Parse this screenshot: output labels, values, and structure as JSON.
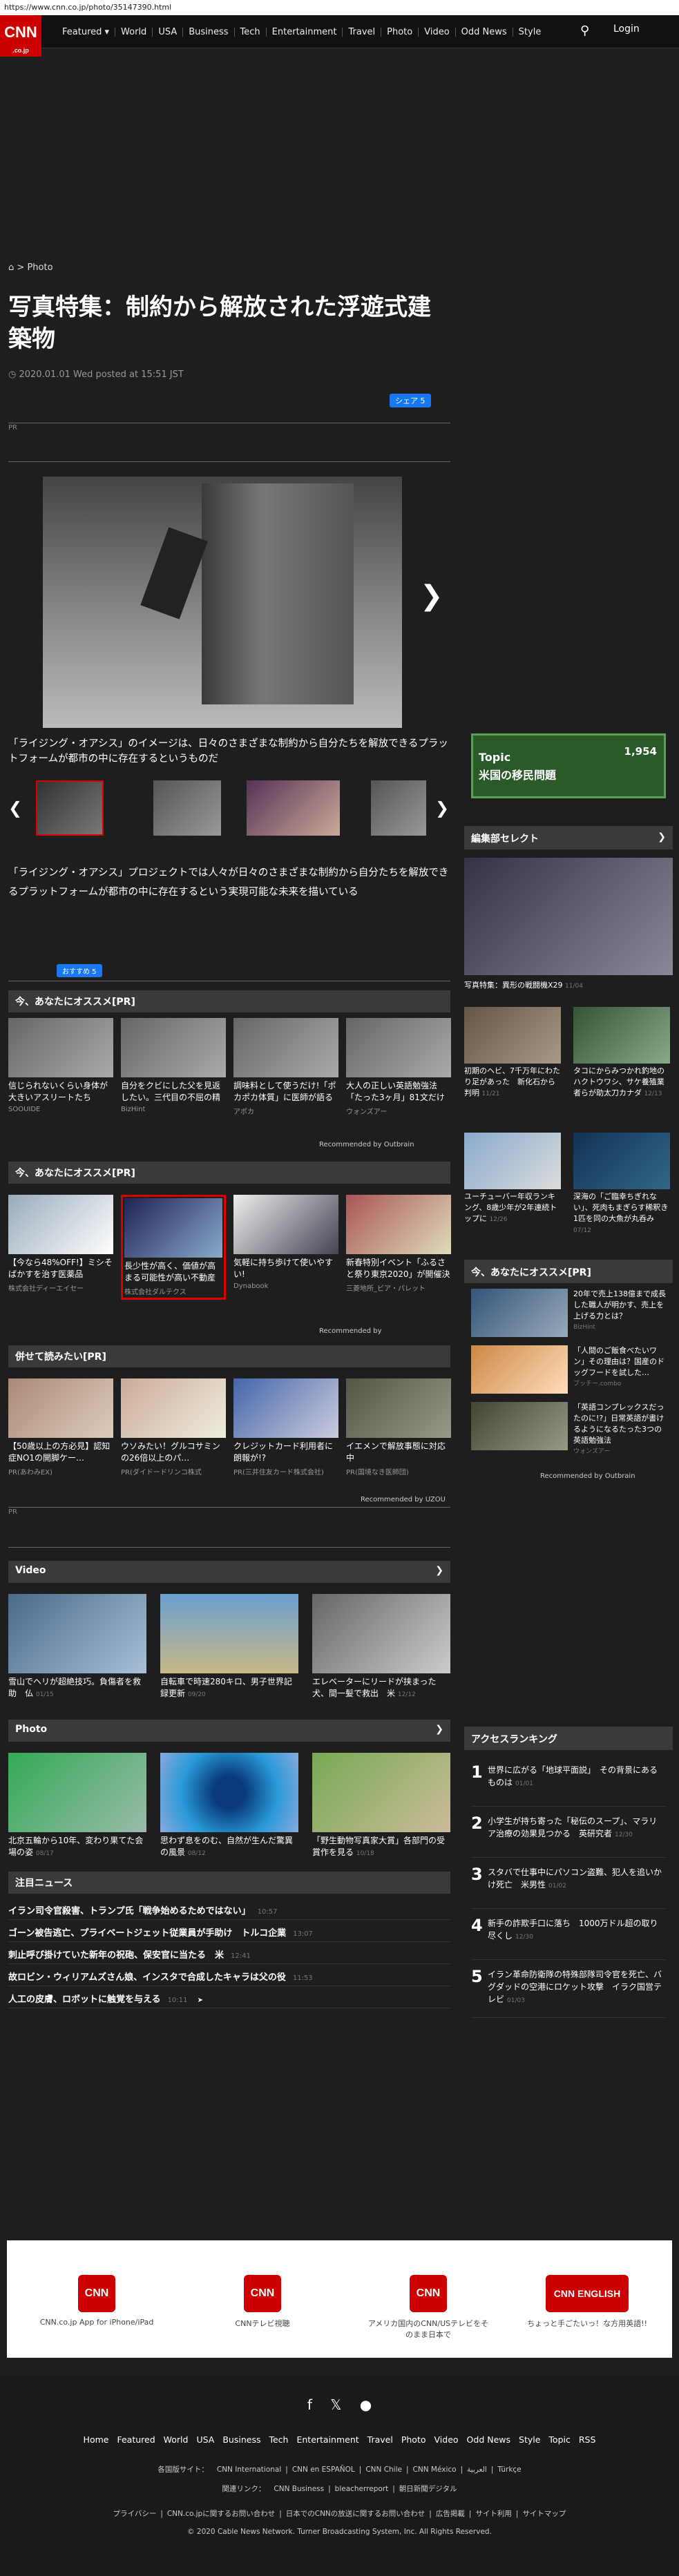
{
  "browser": {
    "url": "https://www.cnn.co.jp/photo/35147390.html"
  },
  "nav": {
    "logo": "CNN",
    "logo_sub": ".co.jp",
    "items": [
      "Featured ▾",
      "World",
      "USA",
      "Business",
      "Tech",
      "Entertainment",
      "Travel",
      "Photo",
      "Video",
      "Odd News",
      "Style"
    ],
    "login": "Login"
  },
  "breadcrumb": {
    "home_icon": "home-icon",
    "section": "Photo"
  },
  "article": {
    "title": "写真特集：制約から解放された浮遊式建築物",
    "date": "2020.01.01 Wed posted at 15:51 JST",
    "share": "シェア 5",
    "pr": "PR",
    "caption": "「ライジング・オアシス」のイメージは、日々のさまざまな制約から自分たちを解放できるプラットフォームが都市の中に存在するというものだ",
    "description": "「ライジング・オアシス」プロジェクトでは人々が日々のさまざまな制約から自分たちを解放できるプラットフォームが都市の中に存在するという実現可能な未来を描いている",
    "fb_recommend": "おすすめ 5"
  },
  "oss1": {
    "header": "今、あなたにオススメ[PR]",
    "cards": [
      {
        "title": "信じられないくらい身体が大きいアスリートたち",
        "source": "SOOUIDE"
      },
      {
        "title": "自分をクビにした父を見返したい。三代目の不屈の精神から生まれた「…",
        "source": "BizHint"
      },
      {
        "title": "調味料として使うだけ!「ポカポカ体質」に医師が語る裏ワザ温活法",
        "source": "アポカ"
      },
      {
        "title": "大人の正しい英語勉強法「たった3ヶ月」81文だけ聞こし続けてみた結果",
        "source": "ウォンズアー"
      }
    ],
    "rec_by": "Recommended by Outbrain"
  },
  "oss2": {
    "header": "今、あなたにオススメ[PR]",
    "cards": [
      {
        "title": "【今なら48%OFF!】ミシそばかすを治す医薬品",
        "source": "株式会社ディーエイセー"
      },
      {
        "title": "長少性が高く、価値が高まる可能性が高い不動産とは?",
        "source": "株式会社ダルテクス"
      },
      {
        "title": "気軽に持ち歩けて使いやすい!",
        "source": "Dynabook"
      },
      {
        "title": "新春特別イベント「ふるさと祭り東京2020」が開催決定!",
        "source": "三菱地所_ビア・パレット"
      }
    ],
    "rec_by": "Recommended by"
  },
  "awase": {
    "header": "併せて読みたい[PR]",
    "cards": [
      {
        "title": "【50歳以上の方必見】認知症NO1の開脚ケー…",
        "source": "PR(あわみEX)"
      },
      {
        "title": "ウソみたい！グルコサミンの26倍以上のパ…",
        "source": "PR(ダイドードリンコ株式"
      },
      {
        "title": "クレジットカード利用者に朗報が!?",
        "source": "PR(三井住友カード株式会社)"
      },
      {
        "title": "イエメンで解放事態に対応中",
        "source": "PR(国境なき医師団)"
      }
    ],
    "rec_by": "Recommended by UZOU",
    "pr": "PR"
  },
  "video": {
    "header": "Video",
    "items": [
      {
        "title": "雪山でヘリが超絶技巧。負傷者を救助　仏",
        "time": "01/15"
      },
      {
        "title": "自転車で時速280キロ、男子世界記録更新",
        "time": "09/20"
      },
      {
        "title": "エレベーターにリードが挟まった犬、間一髪で救出　米",
        "time": "12/12"
      }
    ]
  },
  "photo": {
    "header": "Photo",
    "items": [
      {
        "title": "北京五輪から10年、変わり果てた会場の姿",
        "time": "08/17"
      },
      {
        "title": "思わず息をのむ、自然が生んだ驚異の風景",
        "time": "08/12"
      },
      {
        "title": "「野生動物写真家大賞」各部門の受賞作を見る",
        "time": "10/18"
      }
    ]
  },
  "news": {
    "header": "注目ニュース",
    "items": [
      {
        "title": "イラン司令官殺害、トランプ氏「戦争始めるためではない」",
        "time": "10:57"
      },
      {
        "title": "ゴーン被告逃亡、プライベートジェット従業員が手助け　トルコ企業",
        "time": "13:07"
      },
      {
        "title": "刺止呼び掛けていた新年の祝砲、保安官に当たる　米",
        "time": "12:41"
      },
      {
        "title": "故ロビン・ウィリアムズさん娘、インスタで合成したキャラは父の役",
        "time": "11:53"
      },
      {
        "title": "人工の皮膚、ロボットに触覚を与える",
        "time": "10:11"
      }
    ]
  },
  "sidebar": {
    "topic": {
      "line1": "Topic",
      "line2": "米国の移民問題",
      "figure": "1,954"
    },
    "editors_pick": {
      "header": "編集部セレクト",
      "main_title": "写真特集：異形の戦闘機X29",
      "main_time": "11/04"
    },
    "grid": [
      {
        "title": "初期のヘビ、7千万年にわたり足があった　新化石から判明",
        "time": "11/21"
      },
      {
        "title": "タコにからみつかれ釣地のハクトウワシ、サケ養殖業者らが助太刀カナダ",
        "time": "12/13"
      },
      {
        "title": "ユーチューバー年収ランキング、8歳少年が2年連続トップに",
        "time": "12/26"
      },
      {
        "title": "深海の「ご臨幸ちぎれない」、死肉もまぎらす稀釈き　1匹を同の大魚が丸呑み",
        "time": "07/12"
      }
    ],
    "oss": {
      "header": "今、あなたにオススメ[PR]",
      "rows": [
        {
          "title": "20年で売上138億まで成長した職人が明かす、売上を上げる力とは？",
          "source": "BizHint"
        },
        {
          "title": "「人間のご飯食べたいワン」その理由は？国産のドッグフードを試した…",
          "source": "ブッチー.combo"
        },
        {
          "title": "「英語コンプレックスだったのに!?」日常英語が書けるようになるたった3つの英語勉強法",
          "source": "ウォンズアー"
        }
      ],
      "rec_by": "Recommended by Outbrain"
    },
    "ranking": {
      "header": "アクセスランキング",
      "items": [
        {
          "n": "1",
          "title": "世界に広がる「地球平面説」　その背景にあるものは",
          "time": "01/01"
        },
        {
          "n": "2",
          "title": "小学生が持ち寄った「秘伝のスープ」、マラリア治療の効果見つかる　英研究者",
          "time": "12/30"
        },
        {
          "n": "3",
          "title": "スタバで仕事中にパソコン盗難、犯人を追いかけ死亡　米男性",
          "time": "01/02"
        },
        {
          "n": "4",
          "title": "新手の詐欺手口に落ち　1000万ドル超の取り尽くし",
          "time": "12/30"
        },
        {
          "n": "5",
          "title": "イラン革命防衛隊の特殊部隊司令官を死亡、バグダッドの空港にロケット攻撃　イラク国営テレビ",
          "time": "01/03"
        }
      ]
    }
  },
  "apps": [
    {
      "logo": "CNN",
      "label": "CNN.co.jp App for iPhone/iPad"
    },
    {
      "logo": "CNN",
      "label": "CNNテレビ視聴"
    },
    {
      "logo": "CNN",
      "label": "アメリカ国内のCNN/USテレビをそのまま日本で"
    },
    {
      "logo": "CNN ENGLISH",
      "label": "ちょっと手ごたいっ！な方用英語!!"
    }
  ],
  "footer": {
    "social": [
      "facebook-icon",
      "twitter-icon",
      "rss-icon"
    ],
    "links1": [
      "Home",
      "Featured",
      "World",
      "USA",
      "Business",
      "Tech",
      "Entertainment",
      "Travel",
      "Photo",
      "Video",
      "Odd News",
      "Style",
      "Topic",
      "RSS"
    ],
    "links2": [
      "各国版サイト：",
      "CNN International",
      "CNN en ESPAÑOL",
      "CNN Chile",
      "CNN México",
      "العربية",
      "Türkçe"
    ],
    "links3": [
      "関連リンク：",
      "CNN Business",
      "bleacherreport",
      "朝日新聞デジタル"
    ],
    "links4": [
      "プライバシー",
      "CNN.co.jpに関するお問い合わせ",
      "日本でのCNNの放送に関するお問い合わせ",
      "広告掲載",
      "サイト利用",
      "サイトマップ"
    ],
    "copyright": "© 2020 Cable News Network.  Turner Broadcasting System, Inc.  All Rights Reserved."
  }
}
